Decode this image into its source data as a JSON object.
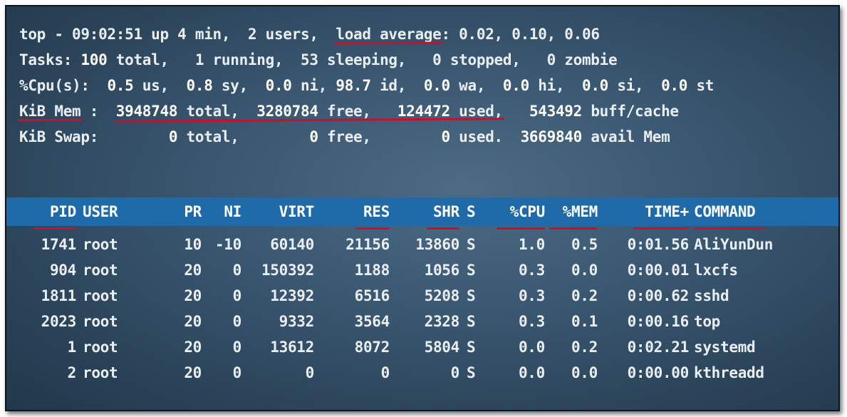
{
  "summary": {
    "line1": {
      "prefix": "top - 09:02:51 up 4 min,  2 users,  ",
      "load_label": "load average",
      "load_values": ": 0.02, 0.10, 0.06"
    },
    "line2": {
      "label": "Tasks: ",
      "total": "100",
      "rest": " total,   1 running,  53 sleeping,   0 stopped,   0 zombie"
    },
    "line3": {
      "label": "%Cpu(s):  ",
      "us": "0.5",
      "us_l": " us,  ",
      "sy": "0.8",
      "sy_l": " sy,  ",
      "ni": "0.0",
      "ni_l": " ni, ",
      "id": "98.7",
      "id_l": " id,  ",
      "wa": "0.0",
      "wa_l": " wa,  ",
      "hi": "0.0",
      "hi_l": " hi,  ",
      "si": "0.0",
      "si_l": " si,  ",
      "st": "0.0",
      "st_l": " st"
    },
    "line4": {
      "label": "KiB Mem",
      "sep": " :  ",
      "total": "3948748",
      "total_l": " total,",
      "gap1": "  ",
      "free": "3280784",
      "free_l": " free,",
      "gap2": "   ",
      "used": "124472",
      "used_l": " used,",
      "gap3": "   ",
      "buff": "543492",
      "buff_l": " buff/cache"
    },
    "line5": {
      "label": "KiB Swap:        ",
      "total": "0",
      "total_l": " total,        ",
      "free": "0",
      "free_l": " free,        ",
      "used": "0",
      "used_l": " used.  ",
      "avail": "3669840",
      "avail_l": " avail Mem"
    }
  },
  "columns": [
    "PID",
    "USER",
    "PR",
    "NI",
    "VIRT",
    "RES",
    "SHR",
    "S",
    "%CPU",
    "%MEM",
    "TIME+",
    "COMMAND"
  ],
  "processes": [
    {
      "pid": "1741",
      "user": "root",
      "pr": "10",
      "ni": "-10",
      "virt": "60140",
      "res": "21156",
      "shr": "13860",
      "s": "S",
      "cpu": "1.0",
      "mem": "0.5",
      "time": "0:01.56",
      "command": "AliYunDun"
    },
    {
      "pid": "904",
      "user": "root",
      "pr": "20",
      "ni": "0",
      "virt": "150392",
      "res": "1188",
      "shr": "1056",
      "s": "S",
      "cpu": "0.3",
      "mem": "0.0",
      "time": "0:00.01",
      "command": "lxcfs"
    },
    {
      "pid": "1811",
      "user": "root",
      "pr": "20",
      "ni": "0",
      "virt": "12392",
      "res": "6516",
      "shr": "5208",
      "s": "S",
      "cpu": "0.3",
      "mem": "0.2",
      "time": "0:00.62",
      "command": "sshd"
    },
    {
      "pid": "2023",
      "user": "root",
      "pr": "20",
      "ni": "0",
      "virt": "9332",
      "res": "3564",
      "shr": "2328",
      "s": "S",
      "cpu": "0.3",
      "mem": "0.1",
      "time": "0:00.16",
      "command": "top"
    },
    {
      "pid": "1",
      "user": "root",
      "pr": "20",
      "ni": "0",
      "virt": "13612",
      "res": "8072",
      "shr": "5804",
      "s": "S",
      "cpu": "0.0",
      "mem": "0.2",
      "time": "0:02.21",
      "command": "systemd"
    },
    {
      "pid": "2",
      "user": "root",
      "pr": "20",
      "ni": "0",
      "virt": "0",
      "res": "0",
      "shr": "0",
      "s": "S",
      "cpu": "0.0",
      "mem": "0.0",
      "time": "0:00.00",
      "command": "kthreadd"
    }
  ]
}
